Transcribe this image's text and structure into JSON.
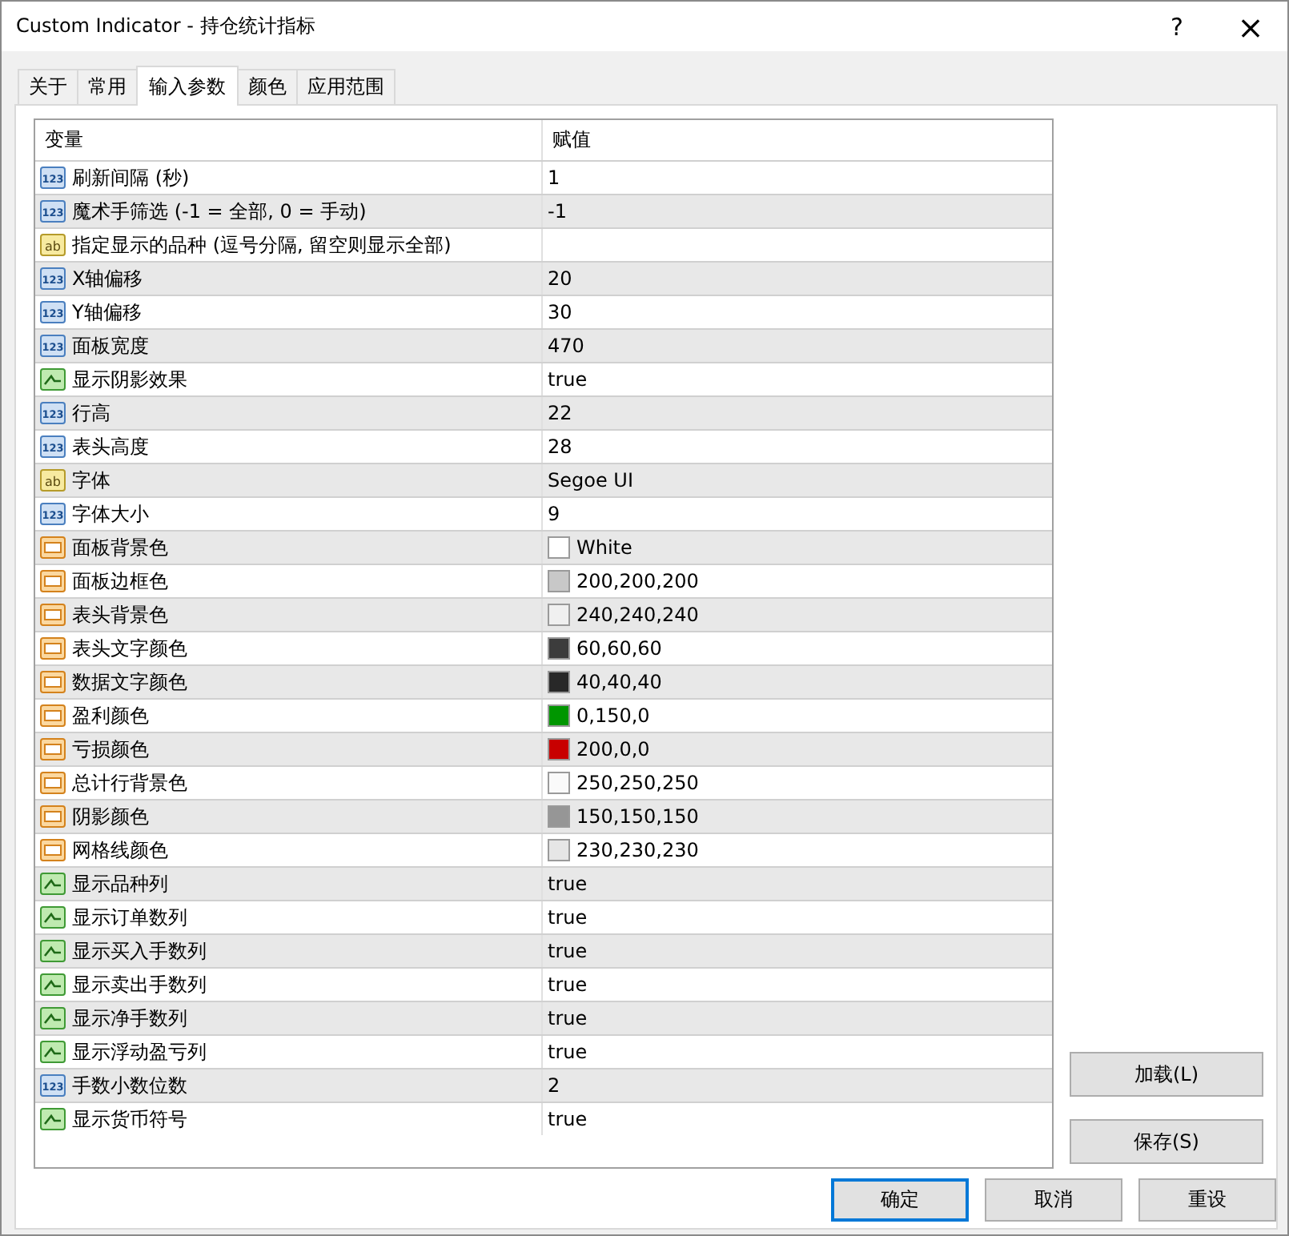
{
  "window": {
    "title": "Custom Indicator - 持仓统计指标",
    "help": "?",
    "close": "×"
  },
  "tabs": [
    {
      "label": "关于",
      "selected": false
    },
    {
      "label": "常用",
      "selected": false
    },
    {
      "label": "输入参数",
      "selected": true
    },
    {
      "label": "颜色",
      "selected": false
    },
    {
      "label": "应用范围",
      "selected": false
    }
  ],
  "table": {
    "columns": [
      "变量",
      "赋值"
    ],
    "rows": [
      {
        "kind": "int",
        "icon_text": "123",
        "name": "刷新间隔 (秒)",
        "value": "1"
      },
      {
        "kind": "int",
        "icon_text": "123",
        "name": "魔术手筛选 (-1 = 全部, 0 = 手动)",
        "value": "-1"
      },
      {
        "kind": "string",
        "icon_text": "ab",
        "name": "指定显示的品种 (逗号分隔, 留空则显示全部)"
      },
      {
        "kind": "int",
        "icon_text": "123",
        "name": "X轴偏移",
        "value": "20"
      },
      {
        "kind": "int",
        "icon_text": "123",
        "name": "Y轴偏移",
        "value": "30"
      },
      {
        "kind": "int",
        "icon_text": "123",
        "name": "面板宽度",
        "value": "470"
      },
      {
        "kind": "bool",
        "name": "显示阴影效果",
        "value": "true"
      },
      {
        "kind": "int",
        "icon_text": "123",
        "name": "行高",
        "value": "22"
      },
      {
        "kind": "int",
        "icon_text": "123",
        "name": "表头高度",
        "value": "28"
      },
      {
        "kind": "string",
        "icon_text": "ab",
        "name": "字体",
        "value": "Segoe UI"
      },
      {
        "kind": "int",
        "icon_text": "123",
        "name": "字体大小",
        "value": "9"
      },
      {
        "kind": "color",
        "name": "面板背景色",
        "value": "White",
        "color": "#ffffff"
      },
      {
        "kind": "color",
        "name": "面板边框色",
        "value": "200,200,200",
        "color": "#c8c8c8"
      },
      {
        "kind": "color",
        "name": "表头背景色",
        "value": "240,240,240",
        "color": "#f0f0f0"
      },
      {
        "kind": "color",
        "name": "表头文字颜色",
        "value": "60,60,60",
        "color": "#3c3c3c"
      },
      {
        "kind": "color",
        "name": "数据文字颜色",
        "value": "40,40,40",
        "color": "#282828"
      },
      {
        "kind": "color",
        "name": "盈利颜色",
        "value": "0,150,0",
        "color": "#009600"
      },
      {
        "kind": "color",
        "name": "亏损颜色",
        "value": "200,0,0",
        "color": "#c80000"
      },
      {
        "kind": "color",
        "name": "总计行背景色",
        "value": "250,250,250",
        "color": "#fafafa"
      },
      {
        "kind": "color",
        "name": "阴影颜色",
        "value": "150,150,150",
        "color": "#969696"
      },
      {
        "kind": "color",
        "name": "网格线颜色",
        "value": "230,230,230",
        "color": "#e6e6e6"
      },
      {
        "kind": "bool",
        "name": "显示品种列",
        "value": "true"
      },
      {
        "kind": "bool",
        "name": "显示订单数列",
        "value": "true"
      },
      {
        "kind": "bool",
        "name": "显示买入手数列",
        "value": "true"
      },
      {
        "kind": "bool",
        "name": "显示卖出手数列",
        "value": "true"
      },
      {
        "kind": "bool",
        "name": "显示净手数列",
        "value": "true"
      },
      {
        "kind": "bool",
        "name": "显示浮动盈亏列",
        "value": "true"
      },
      {
        "kind": "int",
        "icon_text": "123",
        "name": "手数小数位数",
        "value": "2"
      },
      {
        "kind": "bool",
        "name": "显示货币符号",
        "value": "true"
      }
    ]
  },
  "side_buttons": [
    "加载(L)",
    "保存(S)"
  ],
  "buttons": [
    {
      "label": "确定",
      "default": true
    },
    {
      "label": "取消",
      "default": false
    },
    {
      "label": "重设",
      "default": false
    }
  ]
}
